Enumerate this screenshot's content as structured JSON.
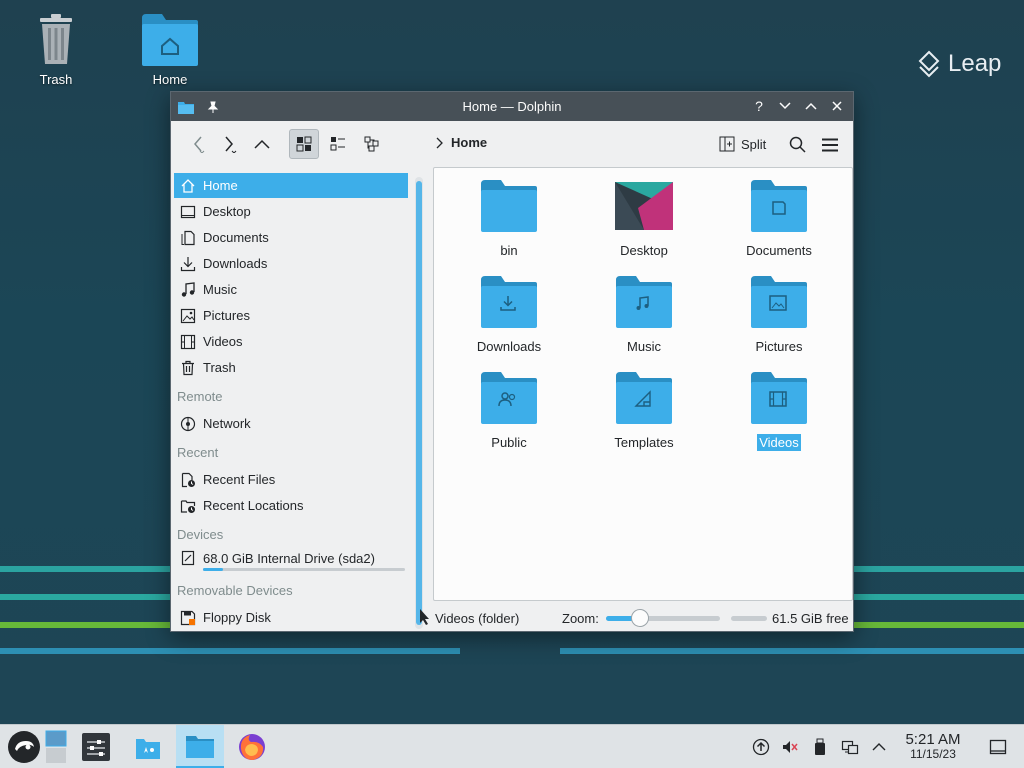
{
  "desktop": {
    "icons": [
      {
        "label": "Trash"
      },
      {
        "label": "Home"
      }
    ],
    "brand": "Leap"
  },
  "window": {
    "title": "Home — Dolphin",
    "toolbar": {
      "breadcrumb": "Home",
      "split_label": "Split"
    },
    "sidebar": {
      "places": [
        {
          "label": "Home",
          "icon": "home-icon",
          "selected": true
        },
        {
          "label": "Desktop",
          "icon": "desktop-icon"
        },
        {
          "label": "Documents",
          "icon": "document-icon"
        },
        {
          "label": "Downloads",
          "icon": "download-icon"
        },
        {
          "label": "Music",
          "icon": "music-icon"
        },
        {
          "label": "Pictures",
          "icon": "picture-icon"
        },
        {
          "label": "Videos",
          "icon": "video-icon"
        },
        {
          "label": "Trash",
          "icon": "trash-icon"
        }
      ],
      "remote_header": "Remote",
      "remote": [
        {
          "label": "Network",
          "icon": "network-icon"
        }
      ],
      "recent_header": "Recent",
      "recent": [
        {
          "label": "Recent Files",
          "icon": "recent-files-icon"
        },
        {
          "label": "Recent Locations",
          "icon": "recent-locations-icon"
        }
      ],
      "devices_header": "Devices",
      "devices": [
        {
          "label": "68.0 GiB Internal Drive (sda2)",
          "icon": "drive-icon",
          "usage_fraction": 0.1
        }
      ],
      "removable_header": "Removable Devices",
      "removable": [
        {
          "label": "Floppy Disk",
          "icon": "floppy-icon"
        }
      ]
    },
    "files": [
      {
        "label": "bin",
        "emblem": "none"
      },
      {
        "label": "Desktop",
        "emblem": "wallpaper"
      },
      {
        "label": "Documents",
        "emblem": "document"
      },
      {
        "label": "Downloads",
        "emblem": "download"
      },
      {
        "label": "Music",
        "emblem": "music"
      },
      {
        "label": "Pictures",
        "emblem": "picture"
      },
      {
        "label": "Public",
        "emblem": "people"
      },
      {
        "label": "Templates",
        "emblem": "template"
      },
      {
        "label": "Videos",
        "emblem": "video",
        "selected": true
      }
    ],
    "status": {
      "selection": "Videos (folder)",
      "zoom_label": "Zoom:",
      "zoom_fraction": 0.3,
      "free_space": "61.5 GiB free"
    }
  },
  "taskbar": {
    "clock_time": "5:21 AM",
    "clock_date": "11/15/23"
  },
  "colors": {
    "accent": "#3daee9",
    "folder": "#3daee9",
    "folder_dark": "#2a8fc4",
    "titlebar": "#475057"
  }
}
